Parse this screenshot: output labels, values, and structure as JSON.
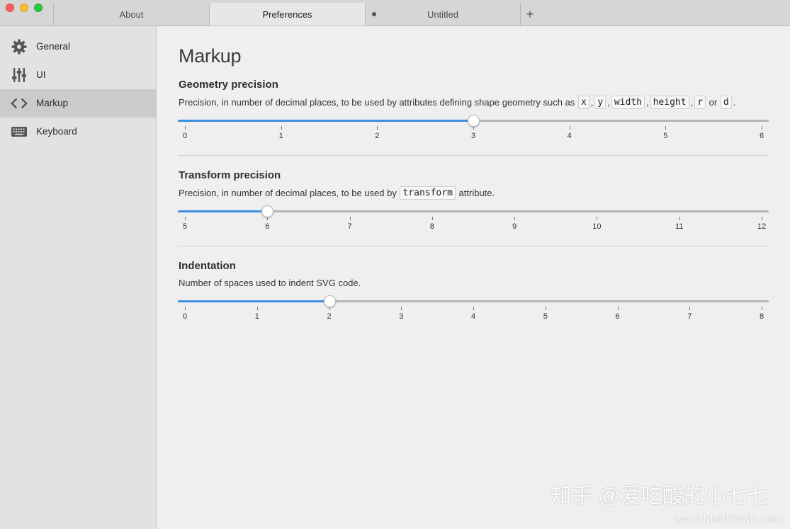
{
  "tabs": [
    {
      "label": "About"
    },
    {
      "label": "Preferences"
    },
    {
      "label": "Untitled"
    }
  ],
  "tab_add_label": "+",
  "sidebar": {
    "items": [
      {
        "label": "General",
        "icon": "gear-icon"
      },
      {
        "label": "UI",
        "icon": "sliders-icon"
      },
      {
        "label": "Markup",
        "icon": "code-icon"
      },
      {
        "label": "Keyboard",
        "icon": "keyboard-icon"
      }
    ],
    "active": "Markup"
  },
  "main": {
    "title": "Markup",
    "sections": [
      {
        "title": "Geometry precision",
        "desc_prefix": "Precision, in number of decimal places, to be used by attributes defining shape geometry such as",
        "desc_codes": [
          "x",
          "y",
          "width",
          "height",
          "r",
          "d"
        ],
        "desc_or": "or",
        "desc_end": ".",
        "slider": {
          "min": 0,
          "max": 6,
          "value": 3,
          "ticks": [
            "0",
            "1",
            "2",
            "3",
            "4",
            "5",
            "6"
          ]
        }
      },
      {
        "title": "Transform precision",
        "desc_prefix": "Precision, in number of decimal places, to be used by",
        "desc_code": "transform",
        "desc_suffix": "attribute.",
        "slider": {
          "min": 5,
          "max": 12,
          "value": 6,
          "ticks": [
            "5",
            "6",
            "7",
            "8",
            "9",
            "10",
            "11",
            "12"
          ]
        }
      },
      {
        "title": "Indentation",
        "desc": "Number of spaces used to indent SVG code.",
        "slider": {
          "min": 0,
          "max": 8,
          "value": 2,
          "ticks": [
            "0",
            "1",
            "2",
            "3",
            "4",
            "5",
            "6",
            "7",
            "8"
          ]
        }
      }
    ]
  },
  "watermark": {
    "line1": "知乎 @爱吃酸的小七七",
    "line2": "www.MacDown.com"
  },
  "colors": {
    "accent": "#3f8fe0",
    "sidebar_bg": "#e2e2e2",
    "sidebar_active": "#cbcbcb",
    "main_bg": "#efefef"
  }
}
